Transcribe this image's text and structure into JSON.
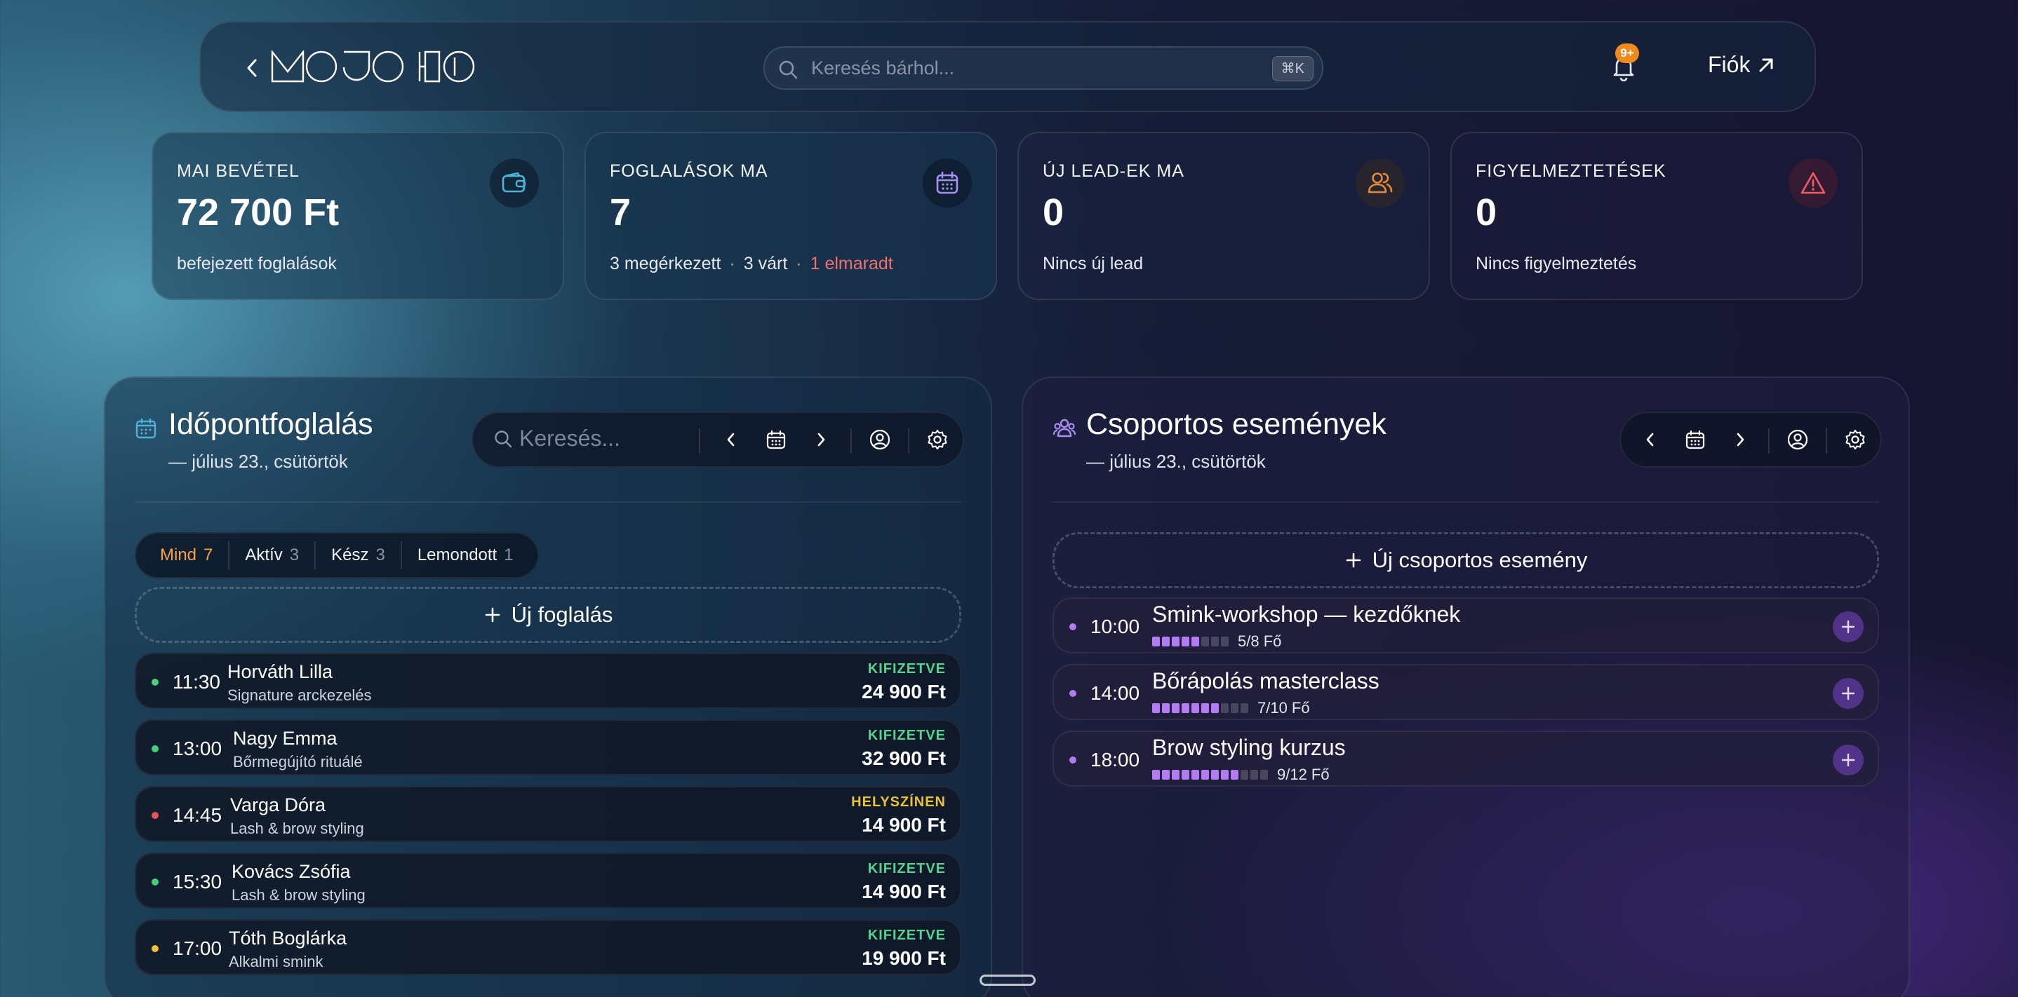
{
  "header": {
    "brand": "MOJO HQ",
    "search_placeholder": "Keresés bárhol...",
    "search_shortcut": "⌘K",
    "notifications_badge": "9+",
    "account_label": "Fiók"
  },
  "stats": [
    {
      "label": "MAI BEVÉTEL",
      "value": "72 700 Ft",
      "sub": "befejezett foglalások",
      "icon": "wallet-icon",
      "color": "#4fb3d9"
    },
    {
      "label": "FOGLALÁSOK MA",
      "value": "7",
      "sub_parts": [
        "3 megérkezett",
        "3 várt",
        "1 elmaradt"
      ],
      "icon": "calendar-icon",
      "color": "#a98ff0"
    },
    {
      "label": "ÚJ LEAD-EK MA",
      "value": "0",
      "sub": "Nincs új lead",
      "icon": "users-icon",
      "color": "#e28a3a"
    },
    {
      "label": "FIGYELMEZTETÉSEK",
      "value": "0",
      "sub": "Nincs figyelmeztetés",
      "icon": "alert-icon",
      "color": "#ef5b67"
    }
  ],
  "bookings_panel": {
    "title": "Időpontfoglalás",
    "date": "— július 23., csütörtök",
    "search_placeholder": "Keresés...",
    "filters": [
      {
        "label": "Mind",
        "count": "7",
        "active": true
      },
      {
        "label": "Aktív",
        "count": "3",
        "active": false
      },
      {
        "label": "Kész",
        "count": "3",
        "active": false
      },
      {
        "label": "Lemondott",
        "count": "1",
        "active": false
      }
    ],
    "new_label": "Új foglalás",
    "bookings": [
      {
        "time": "11:30",
        "name": "Horváth Lilla",
        "service": "Signature arckezelés",
        "status": "KIFIZETVE",
        "price": "24 900 Ft",
        "dot": "#43d17a",
        "status_color": "#52d48c"
      },
      {
        "time": "13:00",
        "name": "Nagy Emma",
        "service": "Bőrmegújító rituálé",
        "status": "KIFIZETVE",
        "price": "32 900 Ft",
        "dot": "#43d17a",
        "status_color": "#52d48c"
      },
      {
        "time": "14:45",
        "name": "Varga Dóra",
        "service": "Lash & brow styling",
        "status": "HELYSZÍNEN",
        "price": "14 900 Ft",
        "dot": "#ef5050",
        "status_color": "#e8c23a"
      },
      {
        "time": "15:30",
        "name": "Kovács Zsófia",
        "service": "Lash & brow styling",
        "status": "KIFIZETVE",
        "price": "14 900 Ft",
        "dot": "#43d17a",
        "status_color": "#52d48c"
      },
      {
        "time": "17:00",
        "name": "Tóth Boglárka",
        "service": "Alkalmi smink",
        "status": "KIFIZETVE",
        "price": "19 900 Ft",
        "dot": "#f2c230",
        "status_color": "#52d48c"
      }
    ]
  },
  "events_panel": {
    "title": "Csoportos események",
    "date": "— július 23., csütörtök",
    "new_label": "Új csoportos esemény",
    "events": [
      {
        "time": "10:00",
        "name": "Smink-workshop — kezdőknek",
        "filled": 5,
        "capacity": 8,
        "label": "5/8 Fő"
      },
      {
        "time": "14:00",
        "name": "Bőrápolás masterclass",
        "filled": 7,
        "capacity": 10,
        "label": "7/10 Fő"
      },
      {
        "time": "18:00",
        "name": "Brow styling kurzus",
        "filled": 9,
        "capacity": 12,
        "label": "9/12 Fő"
      }
    ]
  }
}
